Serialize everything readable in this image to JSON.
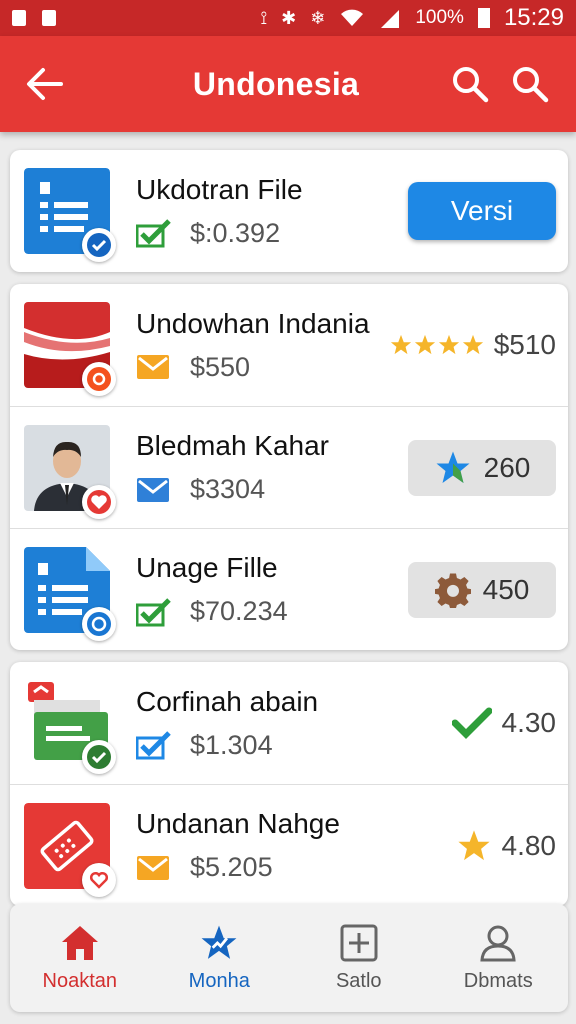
{
  "status_bar": {
    "battery": "100%",
    "time": "15:29"
  },
  "app_bar": {
    "title": "Undonesia",
    "icons": [
      "back-arrow-icon",
      "search-icon",
      "search-icon"
    ]
  },
  "items": [
    {
      "name": "Ukdotran File",
      "price": "$:0.392",
      "right_type": "button",
      "right_label": "Versi",
      "thumb": "document-icon",
      "badge": "check-badge-icon",
      "meta_icon": "green-check-icon"
    },
    {
      "name": "Undowhan Indania",
      "price": "$550",
      "right_type": "rating",
      "rating": 4,
      "right_label": "$510",
      "thumb": "flag-image",
      "badge": "orange-badge-icon",
      "meta_icon": "orange-mail-icon"
    },
    {
      "name": "Bledmah Kahar",
      "price": "$3304",
      "right_type": "chip",
      "right_icon": "star-icon",
      "right_label": "260",
      "thumb": "person-avatar",
      "badge": "heart-badge-icon",
      "meta_icon": "blue-mail-icon"
    },
    {
      "name": "Unage Fille",
      "price": "$70.234",
      "right_type": "chip",
      "right_icon": "gear-icon",
      "right_label": "450",
      "thumb": "document-icon",
      "badge": "blue-ring-badge-icon",
      "meta_icon": "green-check-icon"
    },
    {
      "name": "Corfinah abain",
      "price": "$1.304",
      "right_type": "plain",
      "right_icon": "checkmark-icon",
      "right_label": "4.30",
      "thumb": "folder-icon",
      "badge": "check-badge-icon",
      "meta_icon": "blue-check-icon"
    },
    {
      "name": "Undanan Nahge",
      "price": "$5.205",
      "right_type": "plain",
      "right_icon": "star-icon",
      "right_label": "4.80",
      "thumb": "ticket-icon",
      "badge": "heart-badge-icon",
      "meta_icon": "orange-mail-icon"
    }
  ],
  "bottom_nav": [
    {
      "label": "Noaktan",
      "icon": "home-icon"
    },
    {
      "label": "Monha",
      "icon": "star-trend-icon"
    },
    {
      "label": "Satlo",
      "icon": "add-box-icon"
    },
    {
      "label": "Dbmats",
      "icon": "person-icon"
    }
  ],
  "colors": {
    "status_bar": "#c62828",
    "app_bar": "#e53935",
    "primary_button": "#1e88e5",
    "check_green": "#2e9e3a",
    "star_gold": "#f5b52a"
  }
}
